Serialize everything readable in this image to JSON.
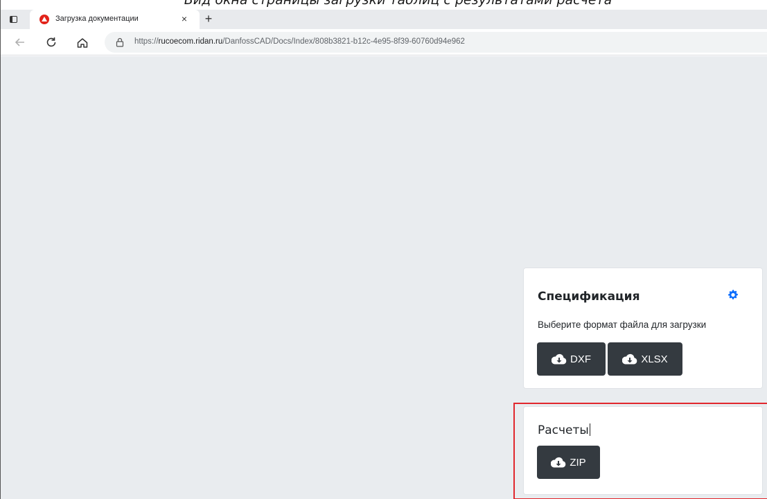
{
  "caption": "Вид окна страницы загрузки таблиц с результатами расчета",
  "browser": {
    "tab_title": "Загрузка документации",
    "tab_close": "×",
    "new_tab": "+",
    "url_prefix": "https://",
    "url_host": "rucoecom.ridan.ru",
    "url_path": "/DanfossCAD/Docs/Index/808b3821-b12c-4e95-8f39-60760d94e962",
    "icons": [
      "tab-actions-icon",
      "favicon-icon",
      "back-icon",
      "reload-icon",
      "home-icon",
      "lock-icon"
    ]
  },
  "page": {
    "background": "#e9ecef",
    "spec_card": {
      "title": "Спецификация",
      "hint": "Выберите формат файла для загрузки",
      "buttons": [
        {
          "label": "DXF",
          "icon": "cloud-download-icon"
        },
        {
          "label": "XLSX",
          "icon": "cloud-download-icon"
        }
      ],
      "settings_icon": "gear-icon"
    },
    "calc_card": {
      "title": "Расчеты",
      "buttons": [
        {
          "label": "ZIP",
          "icon": "cloud-download-icon"
        }
      ]
    }
  },
  "colors": {
    "button_bg": "#343a40",
    "accent_gear": "#0d6efd",
    "highlight_border": "#e1262d",
    "favicon": "#e2231a"
  }
}
